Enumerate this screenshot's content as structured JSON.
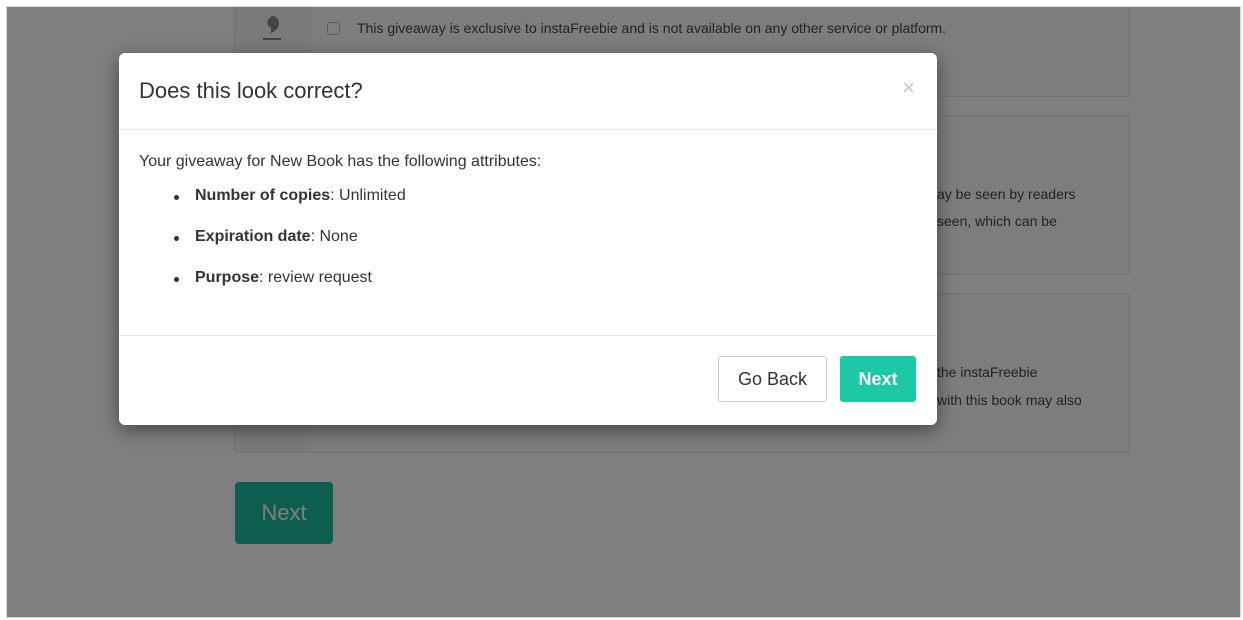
{
  "background": {
    "exclusive_checkbox_label": "This giveaway is exclusive to instaFreebie and is not available on any other service or platform.",
    "panel2_line1": "ay be seen by readers",
    "panel2_line2": "seen, which can be",
    "panel3_line1": "the instaFreebie",
    "panel3_line2": "with this book may also",
    "next_button_label": "Next"
  },
  "modal": {
    "title": "Does this look correct?",
    "close_symbol": "×",
    "intro": "Your giveaway for New Book has the following attributes:",
    "attributes": [
      {
        "label": "Number of copies",
        "value": ": Unlimited"
      },
      {
        "label": "Expiration date",
        "value": ": None"
      },
      {
        "label": "Purpose",
        "value": ": review request"
      }
    ],
    "go_back_label": "Go Back",
    "next_label": "Next"
  },
  "colors": {
    "accent": "#1dc9a5",
    "overlay": "rgba(0,0,0,0.5)"
  }
}
